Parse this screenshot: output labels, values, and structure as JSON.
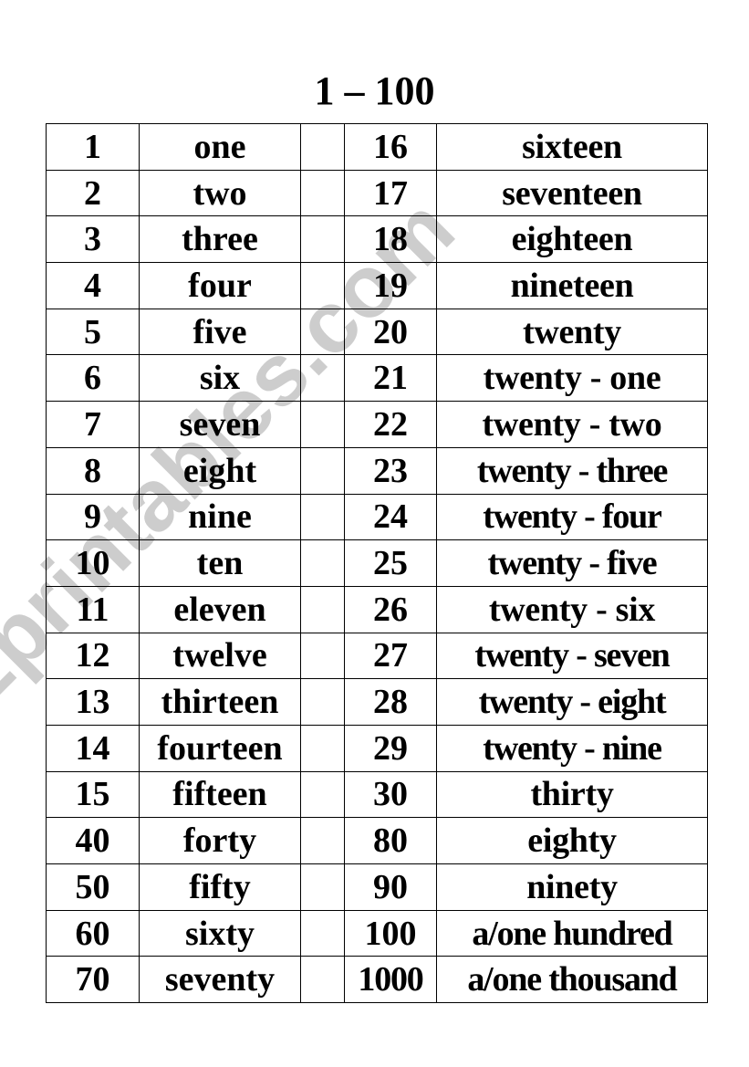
{
  "title": "1 – 100",
  "watermark": "ESLprintables.com",
  "rows": [
    {
      "n1": "1",
      "w1": "one",
      "n2": "16",
      "w2": "sixteen"
    },
    {
      "n1": "2",
      "w1": "two",
      "n2": "17",
      "w2": "seventeen"
    },
    {
      "n1": "3",
      "w1": "three",
      "n2": "18",
      "w2": "eighteen"
    },
    {
      "n1": "4",
      "w1": "four",
      "n2": "19",
      "w2": "nineteen"
    },
    {
      "n1": "5",
      "w1": "five",
      "n2": "20",
      "w2": "twenty"
    },
    {
      "n1": "6",
      "w1": "six",
      "n2": "21",
      "w2": "twenty - one"
    },
    {
      "n1": "7",
      "w1": "seven",
      "n2": "22",
      "w2": "twenty - two"
    },
    {
      "n1": "8",
      "w1": "eight",
      "n2": "23",
      "w2": "twenty - three"
    },
    {
      "n1": "9",
      "w1": "nine",
      "n2": "24",
      "w2": "twenty - four"
    },
    {
      "n1": "10",
      "w1": "ten",
      "n2": "25",
      "w2": "twenty - five"
    },
    {
      "n1": "11",
      "w1": "eleven",
      "n2": "26",
      "w2": "twenty - six"
    },
    {
      "n1": "12",
      "w1": "twelve",
      "n2": "27",
      "w2": "twenty - seven"
    },
    {
      "n1": "13",
      "w1": "thirteen",
      "n2": "28",
      "w2": "twenty - eight"
    },
    {
      "n1": "14",
      "w1": "fourteen",
      "n2": "29",
      "w2": "twenty - nine"
    },
    {
      "n1": "15",
      "w1": "fifteen",
      "n2": "30",
      "w2": "thirty"
    },
    {
      "n1": "40",
      "w1": "forty",
      "n2": "80",
      "w2": "eighty"
    },
    {
      "n1": "50",
      "w1": "fifty",
      "n2": "90",
      "w2": "ninety"
    },
    {
      "n1": "60",
      "w1": "sixty",
      "n2": "100",
      "w2": "a/one hundred"
    },
    {
      "n1": "70",
      "w1": "seventy",
      "n2": "1000",
      "w2": "a/one thousand"
    }
  ]
}
